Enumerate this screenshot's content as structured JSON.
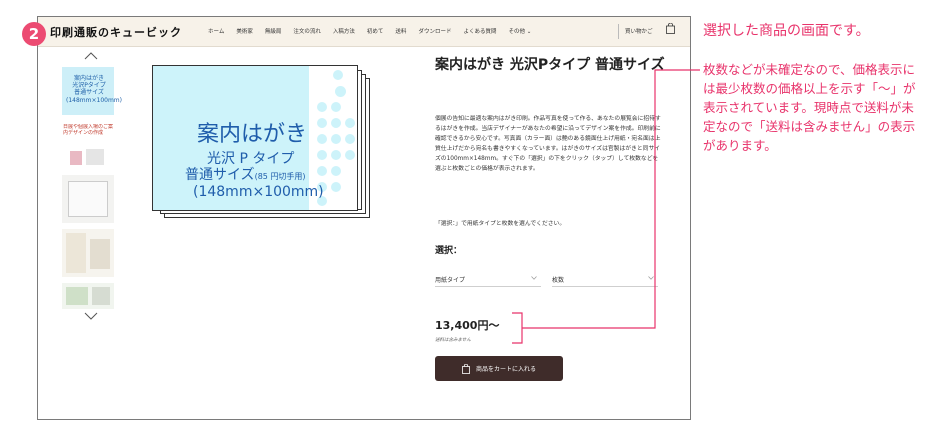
{
  "step_number": "2",
  "header": {
    "logo": "印刷通販のキュービック",
    "nav": [
      "ホーム",
      "美術家",
      "無級局",
      "注文の流れ",
      "入稿方法",
      "初めて",
      "送料",
      "ダウンロード",
      "よくある質問",
      "その他 ⌄"
    ],
    "cart_label": "買い物かご"
  },
  "thumbnails": {
    "t1": "案内はがき\n光沢Pタイプ\n普通サイズ\n(148mm×100mm)",
    "t2": "日展や個展入場のご案内デザインの作成"
  },
  "postcard": {
    "title": "案内はがき",
    "line1": "光沢 P タイプ",
    "line2_main": "普通サイズ",
    "line2_small": "(85 円切手用)",
    "line3": "(148mm×100mm)"
  },
  "product": {
    "title": "案内はがき 光沢Pタイプ 普通サイズ",
    "description": "個展の告知に最適な案内はがき印刷。作品写真を使って作る、あなたの展覧会に招待するはがきを作成。当店デザイナーがあなたの希望に沿ってデザイン案を作成。印刷前に確認できるから安心です。写真面（カラー面）は艶のある鏡面仕上げ用紙・宛名面は上質仕上げだから宛名も書きやすくなっています。はがきのサイズは官製はがきと同サイズの100mm×148mm。すぐ下の「選択」の下をクリック（タップ）して枚数などを選ぶと枚数ごとの価格が表示されます。",
    "note": "「選択：」で用紙タイプと枚数を選んでください。",
    "select_label": "選択：",
    "dropdown1": "用紙タイプ",
    "dropdown2": "枚数",
    "price": "13,400円〜",
    "tax_note": "送料は含みません",
    "cart_button": "商品をカートに入れる"
  },
  "annotation": {
    "title": "選択した商品の画面です。",
    "body": "枚数などが未確定なので、価格表示には最少枚数の価格以上を示す「〜」が表示されています。現時点で送料が未定なので「送料は含みません」の表示があります。"
  },
  "colors": {
    "accent_pink": "#e8336b",
    "card_blue": "#1f5dab",
    "card_fill": "#cdf3fa",
    "header_bg": "#f7f2e9",
    "button_bg": "#3f2c2a"
  }
}
